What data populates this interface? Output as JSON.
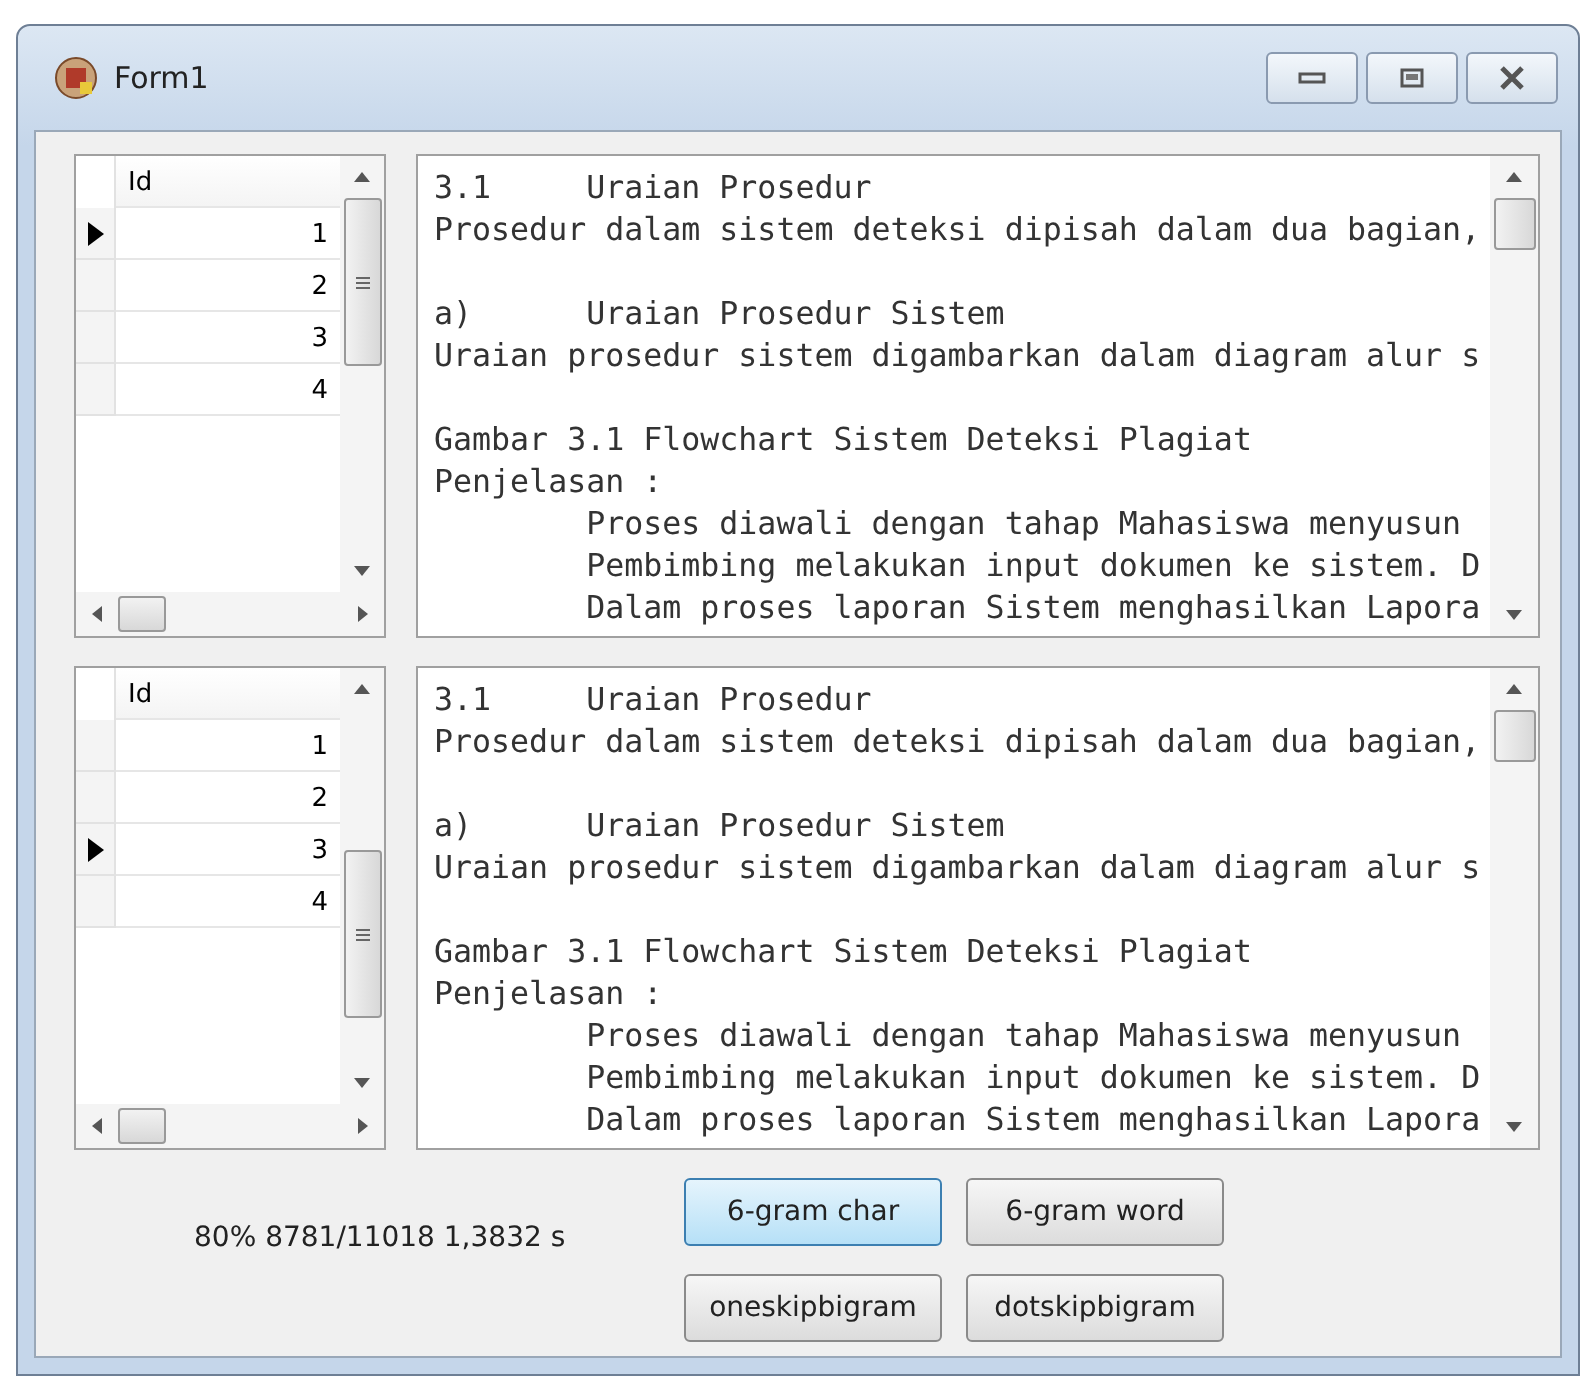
{
  "window": {
    "title": "Form1"
  },
  "panels": [
    {
      "grid": {
        "header": "Id",
        "rows": [
          {
            "id": "1",
            "current": true
          },
          {
            "id": "2",
            "current": false
          },
          {
            "id": "3",
            "current": false
          },
          {
            "id": "4",
            "current": false
          }
        ]
      },
      "text_blocks": [
        [
          "3.1     Uraian Prosedur",
          "Prosedur dalam sistem deteksi dipisah dalam dua bagian,"
        ],
        [
          "a)      Uraian Prosedur Sistem",
          "Uraian prosedur sistem digambarkan dalam diagram alur s"
        ],
        [
          "Gambar 3.1 Flowchart Sistem Deteksi Plagiat",
          "Penjelasan :",
          "        Proses diawali dengan tahap Mahasiswa menyusun",
          "        Pembimbing melakukan input dokumen ke sistem. D",
          "        Dalam proses laporan Sistem menghasilkan Lapora"
        ]
      ]
    },
    {
      "grid": {
        "header": "Id",
        "rows": [
          {
            "id": "1",
            "current": false
          },
          {
            "id": "2",
            "current": false
          },
          {
            "id": "3",
            "current": true
          },
          {
            "id": "4",
            "current": false
          }
        ]
      },
      "text_blocks": [
        [
          "3.1     Uraian Prosedur",
          "Prosedur dalam sistem deteksi dipisah dalam dua bagian,"
        ],
        [
          "a)      Uraian Prosedur Sistem",
          "Uraian prosedur sistem digambarkan dalam diagram alur s"
        ],
        [
          "Gambar 3.1 Flowchart Sistem Deteksi Plagiat",
          "Penjelasan :",
          "        Proses diawali dengan tahap Mahasiswa menyusun",
          "        Pembimbing melakukan input dokumen ke sistem. D",
          "        Dalam proses laporan Sistem menghasilkan Lapora"
        ]
      ]
    }
  ],
  "status": "80% 8781/11018 1,3832 s",
  "buttons": [
    {
      "label": "6-gram char",
      "focused": true
    },
    {
      "label": "6-gram word",
      "focused": false
    },
    {
      "label": "oneskipbigram",
      "focused": false
    },
    {
      "label": "dotskipbigram",
      "focused": false
    }
  ]
}
